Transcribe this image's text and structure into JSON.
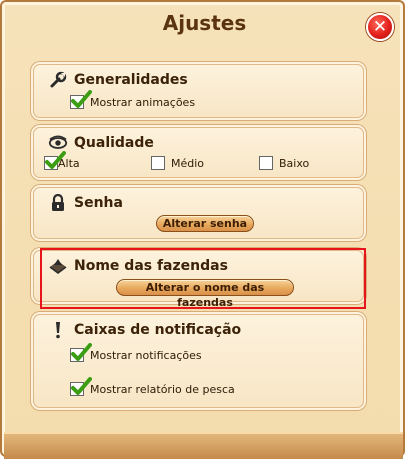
{
  "window": {
    "title": "Ajustes",
    "close_label": "✕"
  },
  "generalidades": {
    "title": "Generalidades",
    "icon": "wrench-icon",
    "option_animations": {
      "label": "Mostrar animações",
      "checked": true
    }
  },
  "qualidade": {
    "title": "Qualidade",
    "icon": "eye-icon",
    "options": [
      {
        "label": "Alta",
        "checked": true
      },
      {
        "label": "Médio",
        "checked": false
      },
      {
        "label": "Baixo",
        "checked": false
      }
    ]
  },
  "senha": {
    "title": "Senha",
    "icon": "lock-icon",
    "button_label": "Alterar senha"
  },
  "fazendas": {
    "title": "Nome das fazendas",
    "icon": "farm-icon",
    "button_label": "Alterar o nome das fazendas"
  },
  "notificacao": {
    "title": "Caixas de notificação",
    "icon": "exclamation-icon",
    "option_notifications": {
      "label": "Mostrar notificações",
      "checked": true
    },
    "option_fishing": {
      "label": "Mostrar relatório de pesca",
      "checked": true
    }
  },
  "colors": {
    "highlight": "#e8141c",
    "check": "#3a9d12",
    "close": "#e3201b"
  }
}
